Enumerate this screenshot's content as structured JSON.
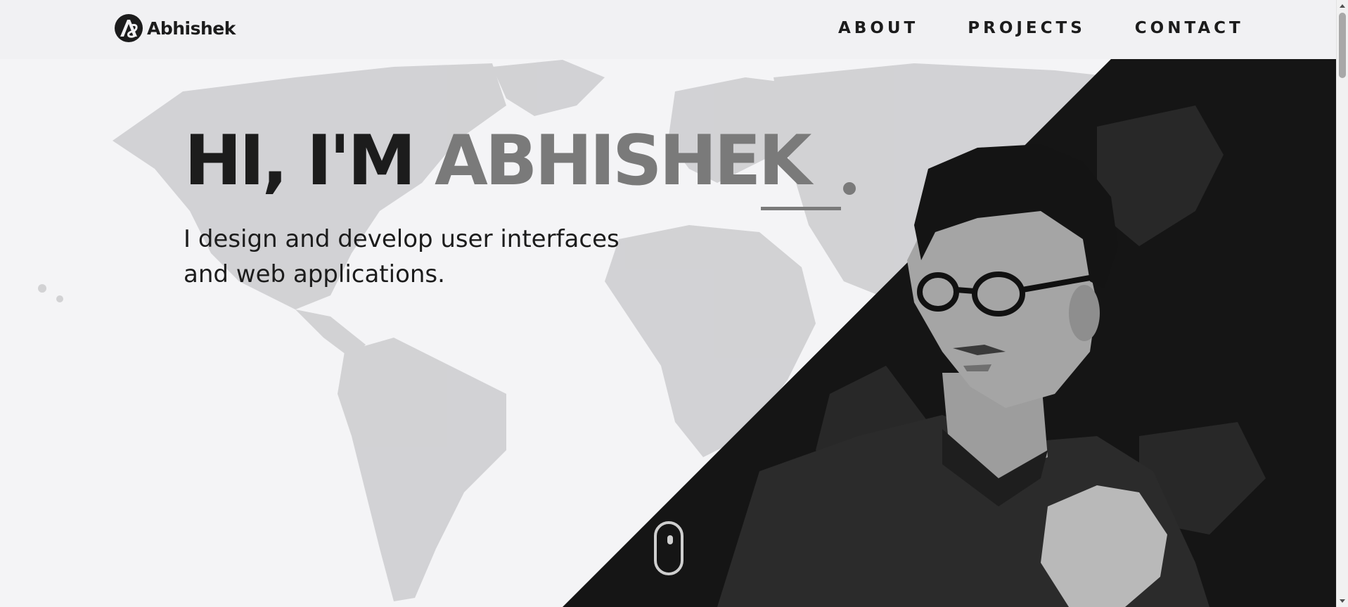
{
  "header": {
    "logo_text": "Abhishek",
    "nav": [
      {
        "label": "ABOUT"
      },
      {
        "label": "PROJECTS"
      },
      {
        "label": "CONTACT"
      }
    ]
  },
  "hero": {
    "title_prefix": "HI, I'M ",
    "title_name": "ABHISHEK",
    "subtitle": "I design and develop user interfaces and web applications."
  },
  "colors": {
    "background": "#f4f4f6",
    "dark_panel": "#151515",
    "text": "#1c1c1c",
    "name_accent": "#7a7a7a"
  },
  "icons": [
    "logo-mark",
    "mouse-scroll-icon"
  ]
}
